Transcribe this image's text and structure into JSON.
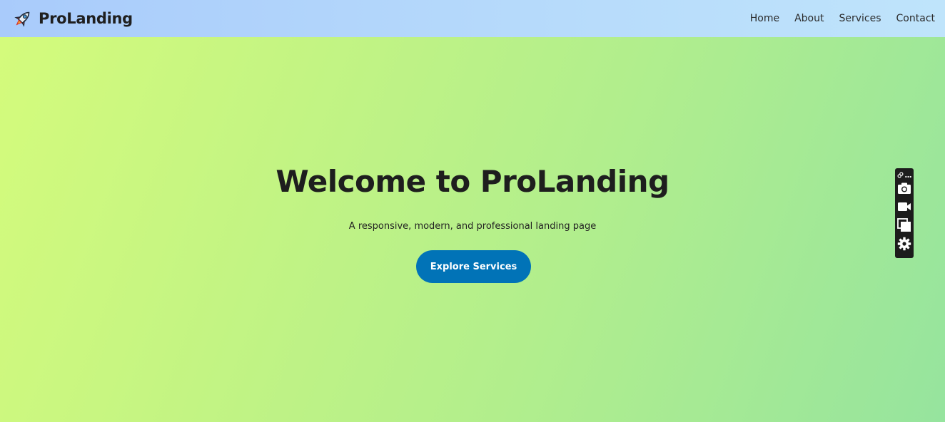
{
  "header": {
    "brand_name": "ProLanding",
    "brand_icon": "rocket-icon",
    "nav": [
      {
        "label": "Home"
      },
      {
        "label": "About"
      },
      {
        "label": "Services"
      },
      {
        "label": "Contact"
      }
    ]
  },
  "hero": {
    "title": "Welcome to ProLanding",
    "subtitle": "A responsive, modern, and professional landing page",
    "cta_label": "Explore Services"
  },
  "toolbar": {
    "icons": [
      "link-icon",
      "more-icon",
      "camera-icon",
      "video-icon",
      "copy-icon",
      "gear-icon"
    ]
  },
  "colors": {
    "header_gradient": [
      "#a9cbfb",
      "#bfe4fb"
    ],
    "hero_gradient": [
      "#d4fb7c",
      "#96e49e"
    ],
    "cta_background": "#0173b7",
    "text": "#1e1e1e"
  }
}
